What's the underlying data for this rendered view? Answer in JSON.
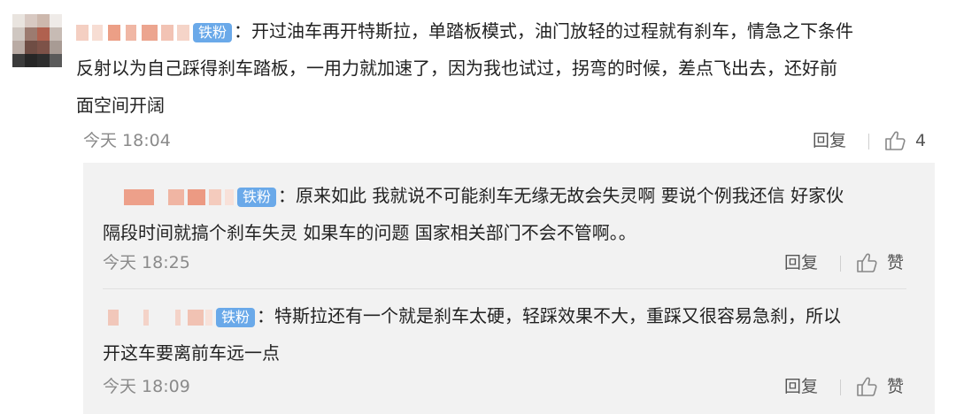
{
  "comment": {
    "badge": "铁粉",
    "text_lines": [
      "：开过油车再开特斯拉，单踏板模式，油门放轻的过程就有刹车，情急之下条件",
      "反射以为自己踩得刹车踏板，一用力就加速了，因为我也试过，拐弯的时候，差点飞出去，还好前",
      "面空间开阔"
    ],
    "time": "今天 18:04",
    "reply_label": "回复",
    "like_count": "4",
    "like_icon": "thumbs-up-icon"
  },
  "replies": [
    {
      "badge": "铁粉",
      "text_lines": [
        "：原来如此 我就说不可能刹车无缘无故会失灵啊 要说个例我还信 好家伙",
        "隔段时间就搞个刹车失灵 如果车的问题 国家相关部门不会不管啊。。"
      ],
      "time": "今天 18:25",
      "reply_label": "回复",
      "like_label": "赞"
    },
    {
      "badge": "铁粉",
      "text_lines": [
        "：特斯拉还有一个就是刹车太硬，轻踩效果不大，重踩又很容易急刹，所以",
        "开这车要离前车远一点"
      ],
      "time": "今天 18:09",
      "reply_label": "回复",
      "like_label": "赞"
    }
  ],
  "colors": {
    "badge": "#6aa9e9",
    "reply_bg": "#f2f2f2",
    "meta_text": "#8a8a8a"
  }
}
